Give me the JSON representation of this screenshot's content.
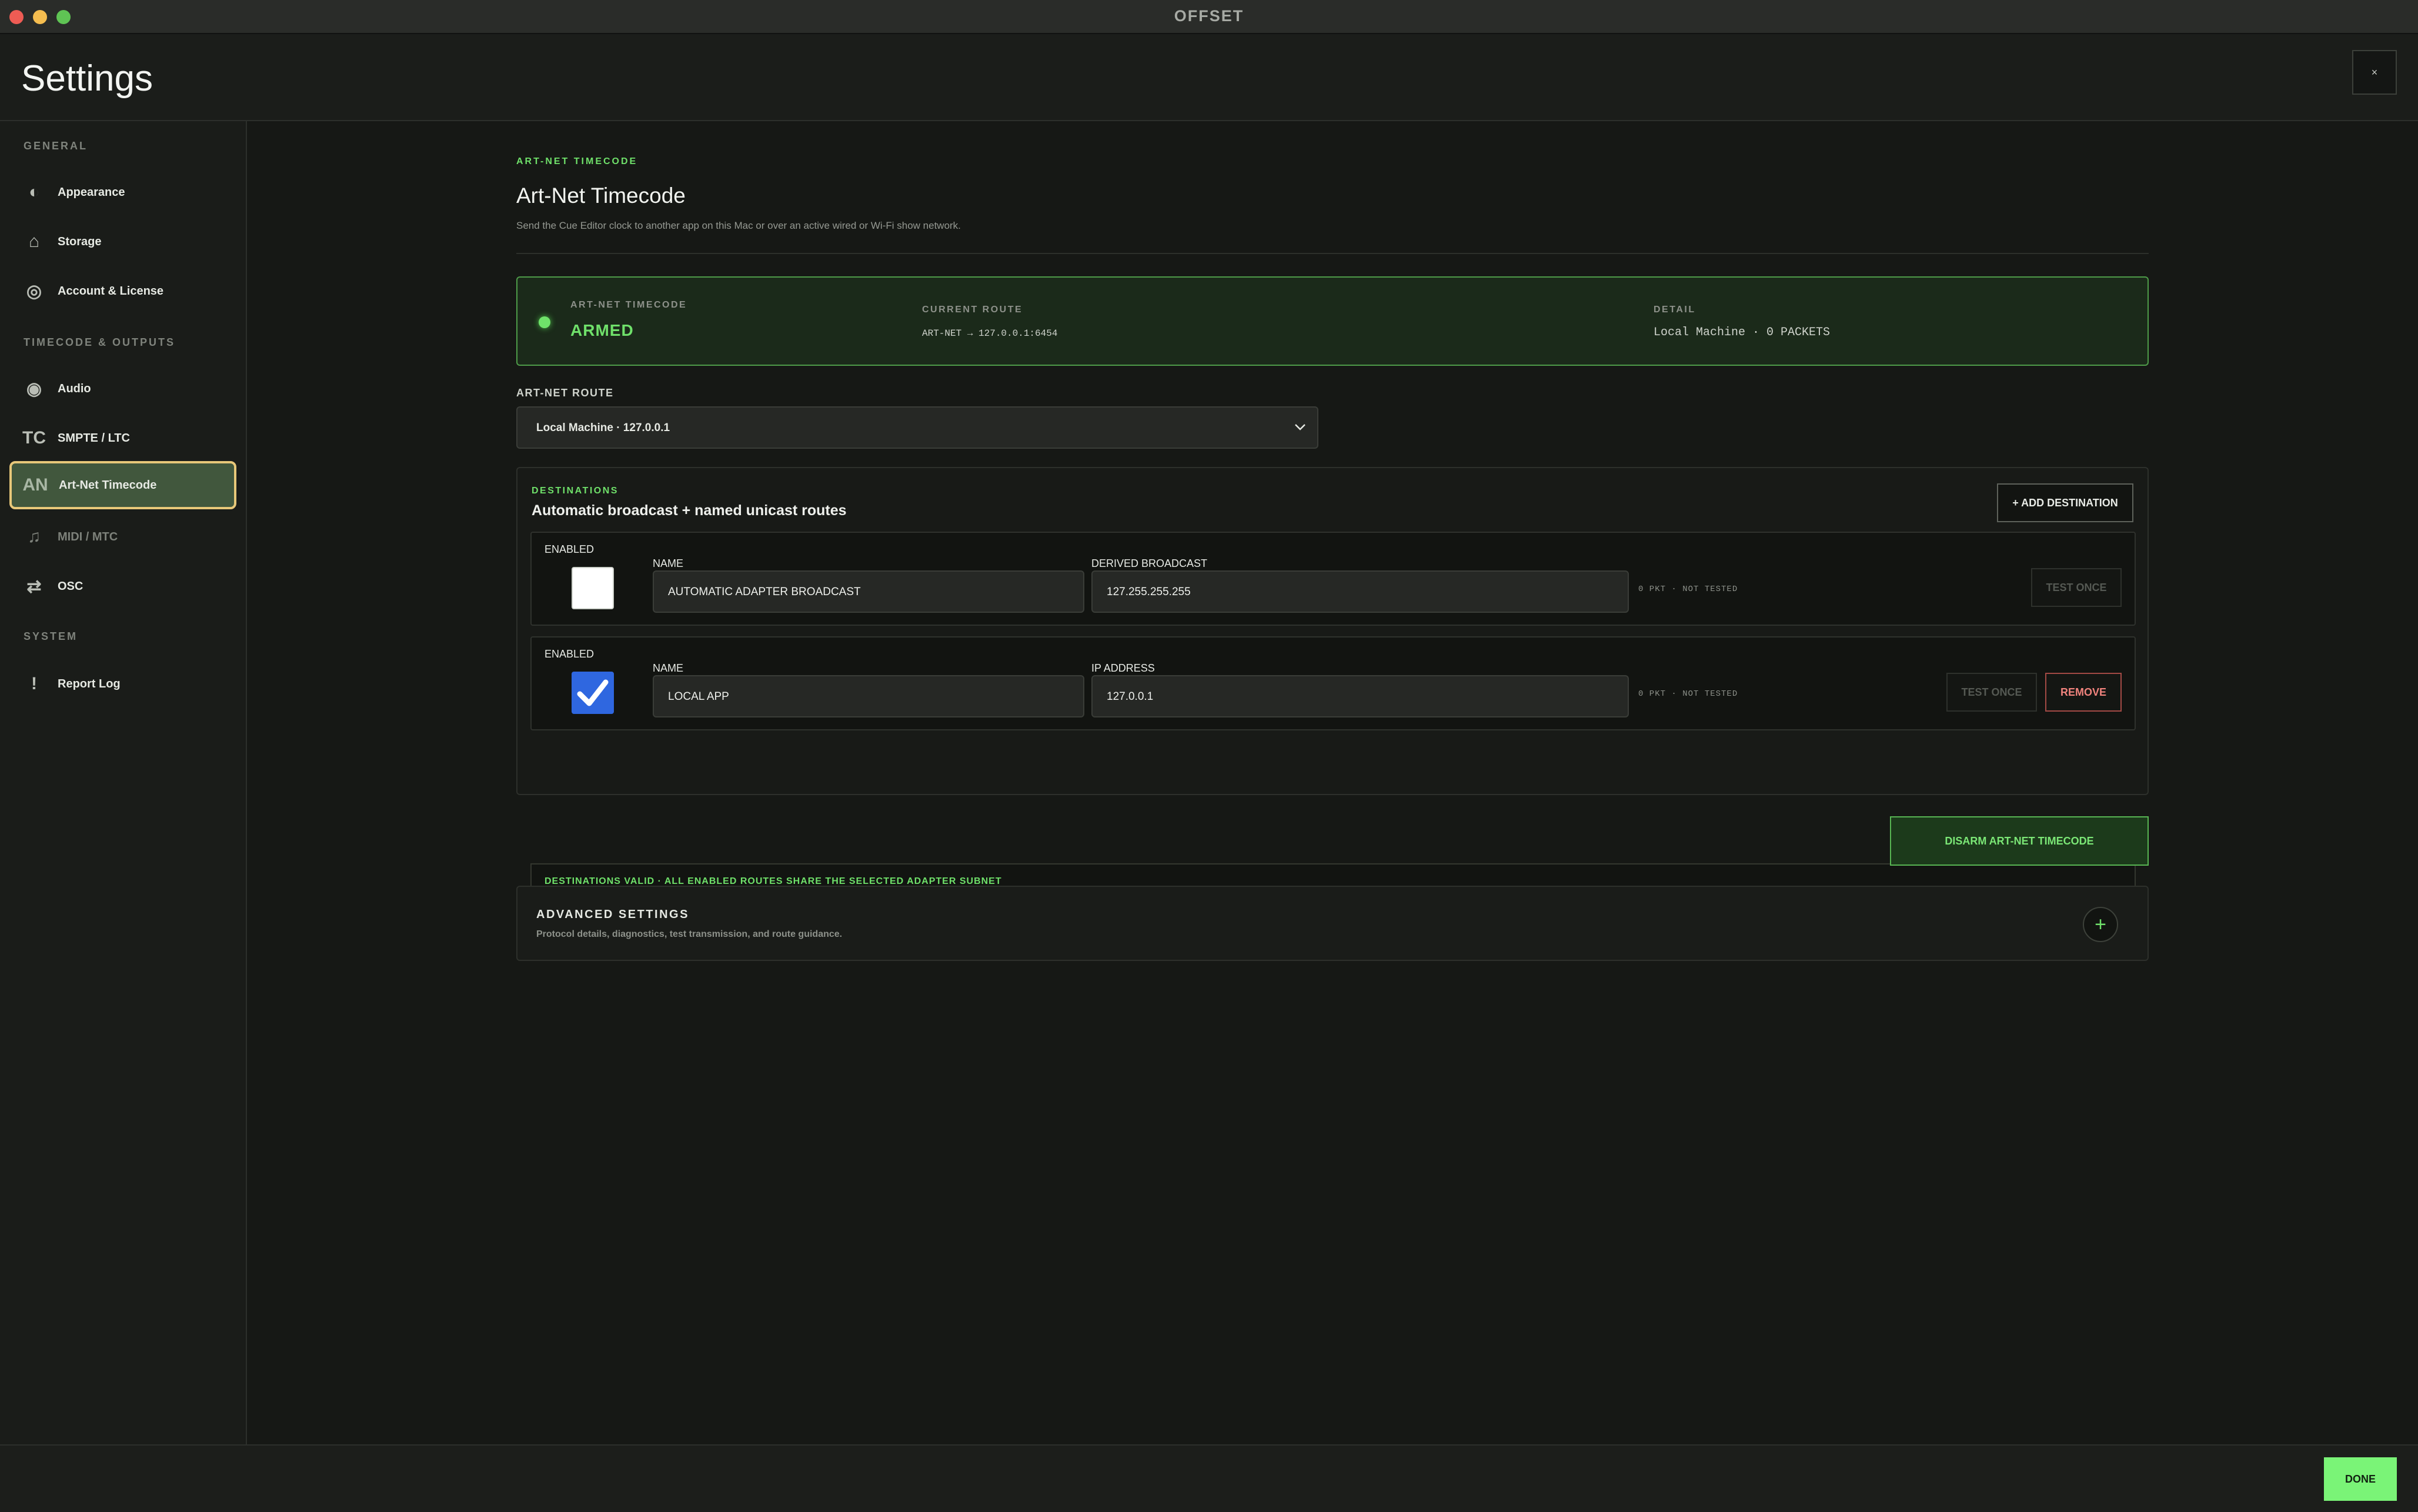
{
  "window": {
    "title": "OFFSET"
  },
  "header": {
    "title": "Settings",
    "close_label": "×"
  },
  "sidebar": {
    "sections": [
      {
        "label": "GENERAL"
      },
      {
        "label": "TIMECODE & OUTPUTS"
      },
      {
        "label": "SYSTEM"
      }
    ],
    "items": [
      {
        "label": "Appearance",
        "icon": "◐",
        "icon_name": "contrast-icon"
      },
      {
        "label": "Storage",
        "icon": "⌂",
        "icon_name": "home-icon"
      },
      {
        "label": "Account & License",
        "icon": "◎",
        "icon_name": "badge-icon"
      },
      {
        "label": "Audio",
        "icon": "◉",
        "icon_name": "audio-icon"
      },
      {
        "label": "SMPTE / LTC",
        "icon": "TC",
        "icon_name": "tc-icon"
      },
      {
        "label": "Art-Net Timecode",
        "icon": "AN",
        "icon_name": "an-icon",
        "active": true
      },
      {
        "label": "MIDI / MTC",
        "icon": "♫",
        "icon_name": "music-note-icon",
        "dim": true
      },
      {
        "label": "OSC",
        "icon": "⇄",
        "icon_name": "arrows-icon"
      },
      {
        "label": "Report Log",
        "icon": "!",
        "icon_name": "alert-icon"
      }
    ]
  },
  "main": {
    "eyebrow": "ART-NET TIMECODE",
    "title": "Art-Net Timecode",
    "description": "Send the Cue Editor clock to another app on this Mac or over an active wired or Wi-Fi show network.",
    "status": {
      "label": "ART-NET TIMECODE",
      "value": "ARMED",
      "route_label": "CURRENT ROUTE",
      "route_value": "ART-NET → 127.0.0.1:6454",
      "detail_label": "DETAIL",
      "detail_value": "Local Machine · 0 PACKETS"
    },
    "route": {
      "label": "ART-NET ROUTE",
      "selected": "Local Machine · 127.0.0.1"
    },
    "destinations": {
      "eyebrow": "DESTINATIONS",
      "title": "Automatic broadcast + named unicast routes",
      "add_label": "+ ADD DESTINATION",
      "rows": [
        {
          "enabled_label": "ENABLED",
          "enabled": false,
          "name_label": "NAME",
          "name": "AUTOMATIC ADAPTER BROADCAST",
          "addr_label": "DERIVED BROADCAST",
          "addr": "127.255.255.255",
          "stats": "0 PKT · NOT TESTED",
          "test_label": "TEST ONCE"
        },
        {
          "enabled_label": "ENABLED",
          "enabled": true,
          "name_label": "NAME",
          "name": "LOCAL APP",
          "addr_label": "IP ADDRESS",
          "addr": "127.0.0.1",
          "stats": "0 PKT · NOT TESTED",
          "test_label": "TEST ONCE",
          "remove_label": "REMOVE"
        }
      ],
      "valid_text": "DESTINATIONS VALID · ALL ENABLED ROUTES SHARE THE SELECTED ADAPTER SUBNET"
    },
    "disarm_label": "DISARM ART-NET TIMECODE",
    "advanced": {
      "title": "ADVANCED SETTINGS",
      "subtitle": "Protocol details, diagnostics, test transmission, and route guidance.",
      "toggle_label": "+"
    }
  },
  "footer": {
    "done_label": "DONE"
  },
  "colors": {
    "accent": "#6fe06a",
    "active_border": "#e7c779",
    "active_bg": "#41573d",
    "checkbox_on": "#2f67e0",
    "danger": "#f0837d"
  }
}
